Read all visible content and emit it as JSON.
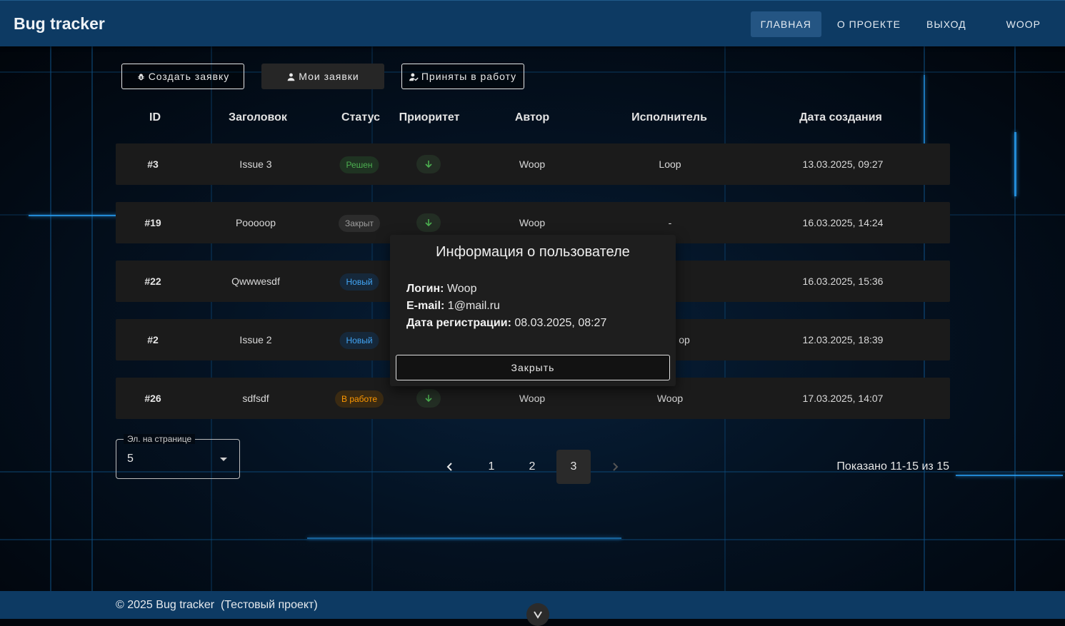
{
  "header": {
    "brand": "Bug tracker",
    "nav": [
      {
        "label": "ГЛАВНАЯ"
      },
      {
        "label": "О ПРОЕКТЕ"
      },
      {
        "label": "ВЫХОД"
      }
    ],
    "user": "WOOP"
  },
  "actions": {
    "create": "Создать заявку",
    "mine": "Мои заявки",
    "accepted": "Приняты в работу"
  },
  "table": {
    "columns": {
      "id": "ID",
      "title": "Заголовок",
      "status": "Статус",
      "priority": "Приоритет",
      "author": "Автор",
      "assignee": "Исполнитель",
      "created": "Дата создания"
    },
    "rows": [
      {
        "id": "#3",
        "title": "Issue 3",
        "status": "Решен",
        "status_color": "#4caf50",
        "status_bg": "#1f3322",
        "author": "Woop",
        "assignee": "Loop",
        "created": "13.03.2025, 09:27"
      },
      {
        "id": "#19",
        "title": "Pooooop",
        "status": "Закрыт",
        "status_color": "#9e9e9e",
        "status_bg": "#2c2c2c",
        "author": "Woop",
        "assignee": "-",
        "created": "16.03.2025, 14:24"
      },
      {
        "id": "#22",
        "title": "Qwwwesdf",
        "status": "Новый",
        "status_color": "#42a5f5",
        "status_bg": "#16283a",
        "author": "",
        "assignee": "",
        "created": "16.03.2025, 15:36"
      },
      {
        "id": "#2",
        "title": "Issue 2",
        "status": "Новый",
        "status_color": "#42a5f5",
        "status_bg": "#16283a",
        "author": "",
        "assignee": "op",
        "created": "12.03.2025, 18:39"
      },
      {
        "id": "#26",
        "title": "sdfsdf",
        "status": "В работе",
        "status_color": "#ff9800",
        "status_bg": "#3a2a12",
        "author": "Woop",
        "assignee": "Woop",
        "created": "17.03.2025, 14:07"
      }
    ],
    "priority_icon": "arrow-down-icon",
    "priority_color": "#4caf50"
  },
  "per_page": {
    "label": "Эл. на странице",
    "value": "5"
  },
  "pagination": {
    "pages": [
      "1",
      "2",
      "3"
    ],
    "current": "3",
    "summary": "Показано 11-15 из 15"
  },
  "footer": {
    "copyright": "© 2025 Bug tracker  (Тестовый проект)"
  },
  "modal": {
    "title": "Информация о пользователе",
    "login_label": "Логин:",
    "login": "Woop",
    "email_label": "E-mail:",
    "email": "1@mail.ru",
    "reg_label": "Дата регистрации:",
    "reg": "08.03.2025, 08:27",
    "close": "Закрыть"
  }
}
